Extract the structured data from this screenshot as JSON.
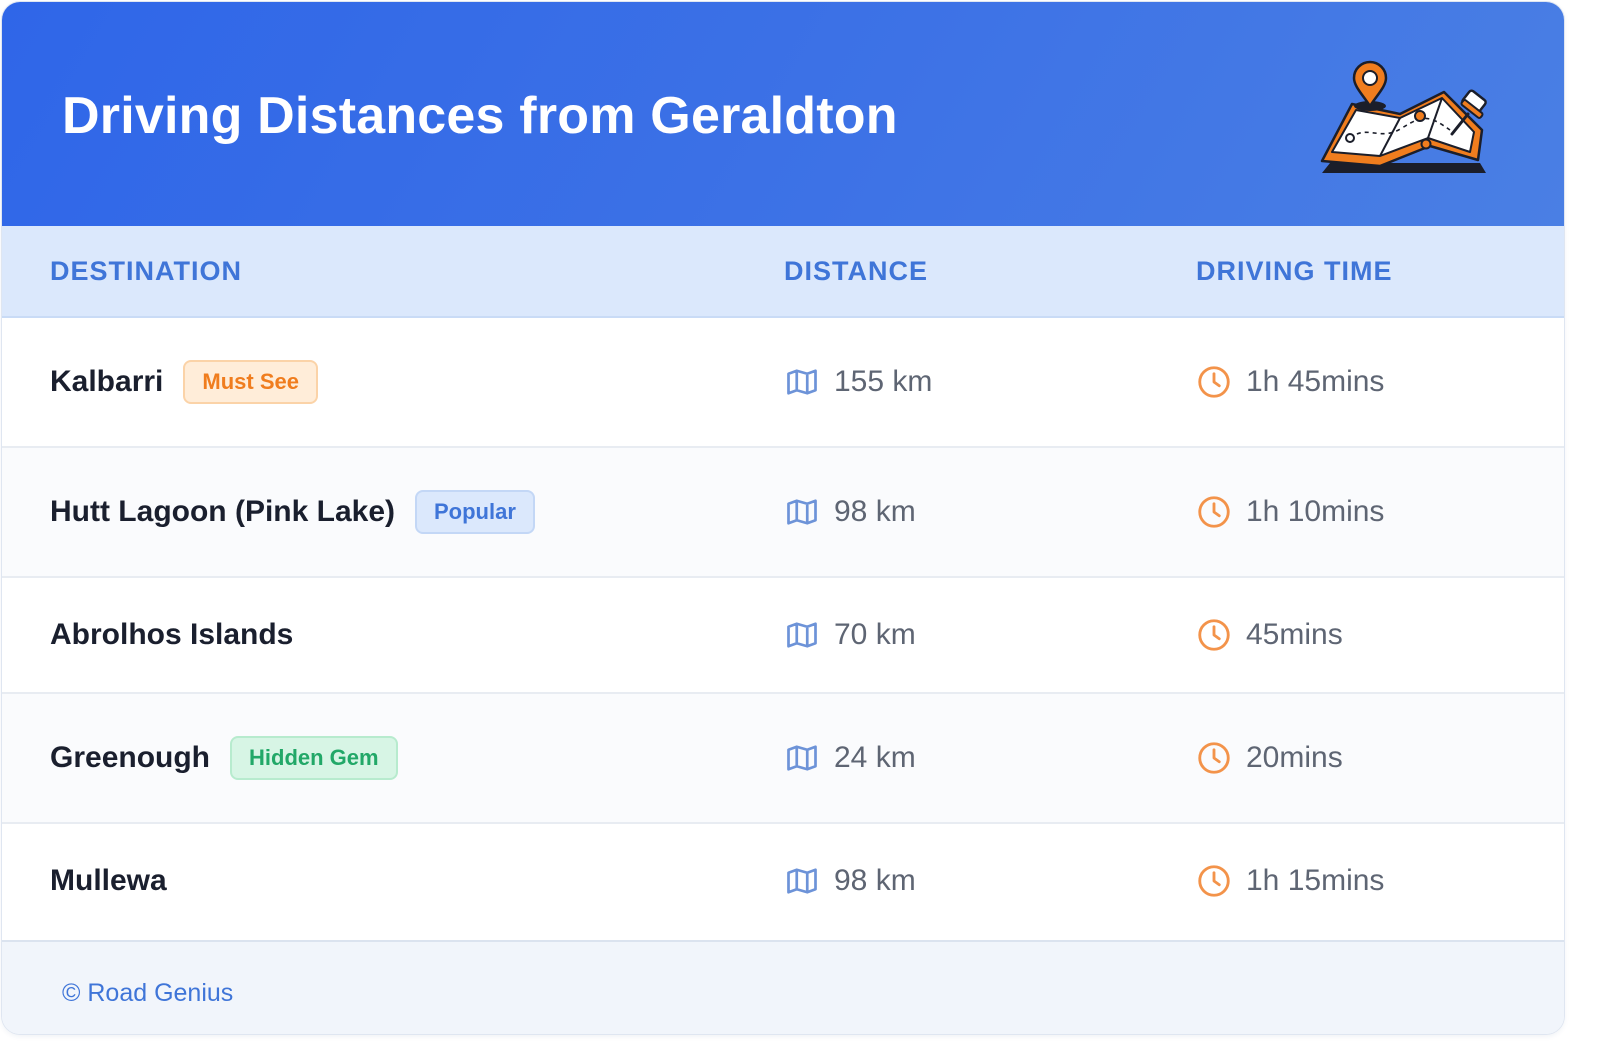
{
  "header": {
    "title": "Driving Distances from Geraldton",
    "illustration_icon": "folded-map-with-pins-icon"
  },
  "table": {
    "columns": [
      "DESTINATION",
      "DISTANCE",
      "DRIVING TIME"
    ],
    "rows": [
      {
        "destination": "Kalbarri",
        "badge": "Must See",
        "badge_color": "#f07d1e",
        "distance": "155 km",
        "time": "1h 45mins"
      },
      {
        "destination": "Hutt Lagoon (Pink Lake)",
        "badge": "Popular",
        "badge_color": "#3f75d8",
        "distance": "98 km",
        "time": "1h 10mins"
      },
      {
        "destination": "Abrolhos Islands",
        "distance": "70 km",
        "time": "45mins"
      },
      {
        "destination": "Greenough",
        "badge": "Hidden Gem",
        "badge_color": "#22a868",
        "distance": "24 km",
        "time": "20mins"
      },
      {
        "destination": "Mullewa",
        "distance": "98 km",
        "time": "1h 15mins"
      }
    ],
    "distance_icon": "map-icon",
    "time_icon": "clock-icon"
  },
  "footer": {
    "text": "© Road Genius"
  },
  "colors": {
    "header_gradient_start": "#2f66e8",
    "header_gradient_end": "#4a7fe4",
    "accent_blue": "#3f75d8",
    "accent_orange": "#f07d1e",
    "table_header_bg": "#dbe8fc"
  }
}
